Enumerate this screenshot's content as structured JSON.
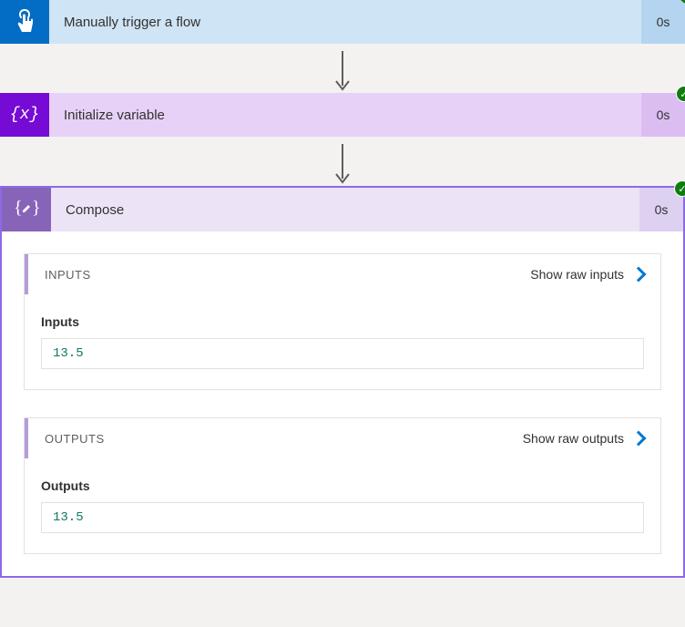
{
  "trigger": {
    "title": "Manually trigger a flow",
    "time": "0s",
    "status": "success"
  },
  "variable": {
    "title": "Initialize variable",
    "time": "0s",
    "status": "success"
  },
  "compose": {
    "title": "Compose",
    "time": "0s",
    "status": "success",
    "inputs_section_label": "INPUTS",
    "show_raw_inputs_label": "Show raw inputs",
    "inputs_field_label": "Inputs",
    "inputs_value": "13.5",
    "outputs_section_label": "OUTPUTS",
    "show_raw_outputs_label": "Show raw outputs",
    "outputs_field_label": "Outputs",
    "outputs_value": "13.5"
  }
}
